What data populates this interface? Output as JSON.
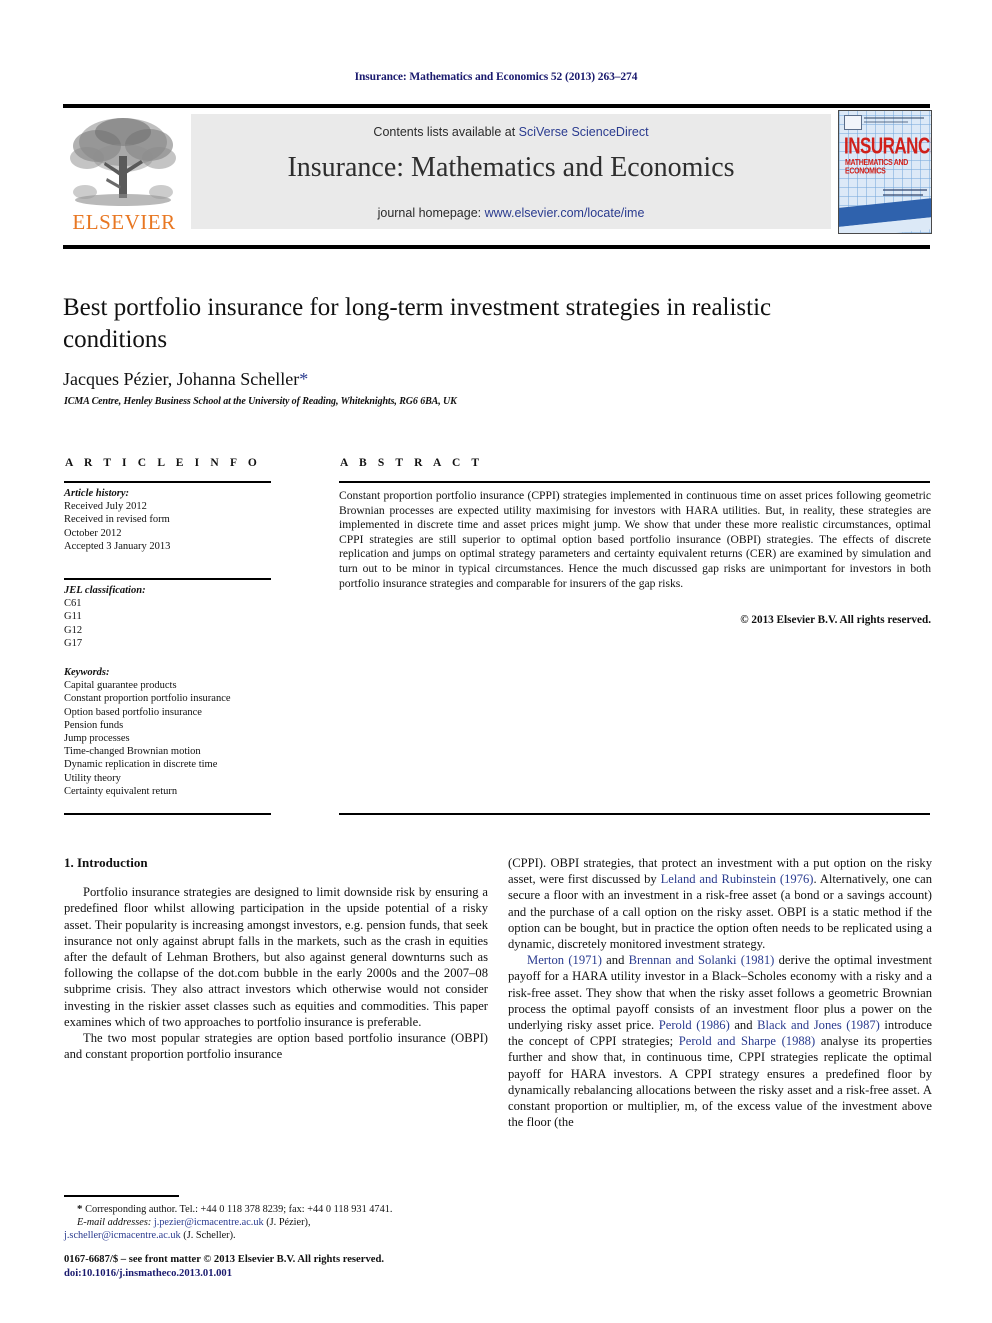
{
  "running_head": "Insurance: Mathematics and Economics 52 (2013) 263–274",
  "masthead": {
    "contents_prefix": "Contents lists available at ",
    "contents_link": "SciVerse ScienceDirect",
    "journal_title": "Insurance: Mathematics and Economics",
    "homepage_prefix": "journal homepage: ",
    "homepage_link": "www.elsevier.com/locate/ime",
    "publisher": "ELSEVIER",
    "cover": {
      "title": "INSURANCE",
      "subtitle": "MATHEMATICS AND ECONOMICS"
    }
  },
  "article": {
    "title": "Best portfolio insurance for long-term investment strategies in realistic conditions",
    "authors": "Jacques Pézier, Johanna Scheller",
    "corresponding_marker": "*",
    "affiliation": "ICMA Centre, Henley Business School at the University of Reading, Whiteknights, RG6 6BA, UK"
  },
  "sections": {
    "article_info_heading": "A R T I C L E    I N F O",
    "abstract_heading": "A B S T R A C T"
  },
  "article_info": {
    "history_label": "Article history:",
    "history_lines": [
      "Received July 2012",
      "Received in revised form",
      "October 2012",
      "Accepted 3 January 2013"
    ],
    "jel_label": "JEL classification:",
    "jel_codes": [
      "C61",
      "G11",
      "G12",
      "G17"
    ],
    "keywords_label": "Keywords:",
    "keywords": [
      "Capital guarantee products",
      "Constant proportion portfolio insurance",
      "Option based portfolio insurance",
      "Pension funds",
      "Jump processes",
      "Time-changed Brownian motion",
      "Dynamic replication in discrete time",
      "Utility theory",
      "Certainty equivalent return"
    ]
  },
  "abstract": {
    "text": "Constant proportion portfolio insurance (CPPI) strategies implemented in continuous time on asset prices following geometric Brownian processes are expected utility maximising for investors with HARA utilities. But, in reality, these strategies are implemented in discrete time and asset prices might jump. We show that under these more realistic circumstances, optimal CPPI strategies are still superior to optimal option based portfolio insurance (OBPI) strategies. The effects of discrete replication and jumps on optimal strategy parameters and certainty equivalent returns (CER) are examined by simulation and turn out to be minor in typical circumstances. Hence the much discussed gap risks are unimportant for investors in both portfolio insurance strategies and comparable for insurers of the gap risks.",
    "copyright": "© 2013 Elsevier B.V. All rights reserved."
  },
  "body": {
    "section_number_title": "1. Introduction",
    "left_para_1": "Portfolio insurance strategies are designed to limit downside risk by ensuring a predefined floor whilst allowing participation in the upside potential of a risky asset. Their popularity is increasing amongst investors, e.g. pension funds, that seek insurance not only against abrupt falls in the markets, such as the crash in equities after the default of Lehman Brothers, but also against general downturns such as following the collapse of the dot.com bubble in the early 2000s and the 2007–08 subprime crisis. They also attract investors which otherwise would not consider investing in the riskier asset classes such as equities and commodities. This paper examines which of two approaches to portfolio insurance is preferable.",
    "left_para_2": "The two most popular strategies are option based portfolio insurance (OBPI) and constant proportion portfolio insurance",
    "right_para_1_a": "(CPPI). OBPI strategies, that protect an investment with a put option on the risky asset, were first discussed by ",
    "right_para_1_cite1": "Leland and Rubinstein (1976)",
    "right_para_1_b": ". Alternatively, one can secure a floor with an investment in a risk-free asset (a bond or a savings account) and the purchase of a call option on the risky asset. OBPI is a static method if the option can be bought, but in practice the option often needs to be replicated using a dynamic, discretely monitored investment strategy.",
    "right_para_2_cite1": "Merton (1971)",
    "right_para_2_a": " and ",
    "right_para_2_cite2": "Brennan and Solanki (1981)",
    "right_para_2_b": " derive the optimal investment payoff for a HARA utility investor in a Black–Scholes economy with a risky and a risk-free asset. They show that when the risky asset follows a geometric Brownian process the optimal payoff consists of an investment floor plus a power on the underlying risky asset price. ",
    "right_para_2_cite3": "Perold (1986)",
    "right_para_2_c": " and ",
    "right_para_2_cite4": "Black and Jones (1987)",
    "right_para_2_d": " introduce the concept of CPPI strategies; ",
    "right_para_2_cite5": "Perold and Sharpe (1988)",
    "right_para_2_e": " analyse its properties further and show that, in continuous time, CPPI strategies replicate the optimal payoff for HARA investors. A CPPI strategy ensures a predefined floor by dynamically rebalancing allocations between the risky asset and a risk-free asset. A constant proportion or multiplier, m, of the excess value of the investment above the floor (the"
  },
  "footnote": {
    "star": "*",
    "corresponding": " Corresponding author. Tel.: +44 0 118 378 8239; fax: +44 0 118 931 4741.",
    "emails_label": "E-mail addresses:",
    "email_1": "j.pezier@icmacentre.ac.uk",
    "email_1_name": " (J. Pézier),",
    "email_2": "j.scheller@icmacentre.ac.uk",
    "email_2_name": " (J. Scheller)."
  },
  "imprint": {
    "front_matter": "0167-6687/$ – see front matter © 2013 Elsevier B.V. All rights reserved.",
    "doi": "doi:10.1016/j.insmatheco.2013.01.001"
  },
  "colors": {
    "link_blue": "#2a3b8f",
    "running_head_blue": "#1a1a6e",
    "elsevier_orange": "#e87722",
    "banner_gray": "#eaeaea",
    "cover_red": "#d0201a",
    "cover_blue": "#2f62ad"
  }
}
